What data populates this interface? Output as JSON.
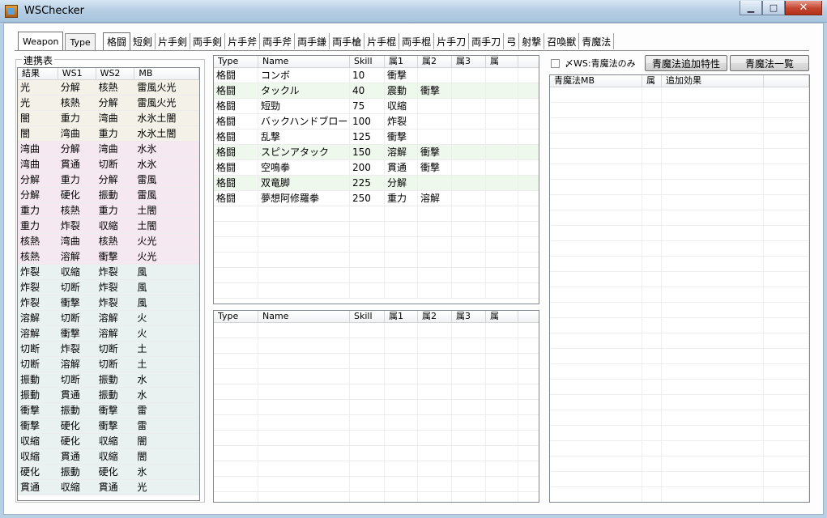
{
  "window": {
    "title": "WSChecker",
    "minimize": "▁",
    "maximize": "□",
    "close": "✕"
  },
  "tabs_type": [
    {
      "label": "Weapon",
      "active": true
    },
    {
      "label": "Type",
      "active": false
    }
  ],
  "tabs_weapon": [
    {
      "label": "格闘",
      "active": true
    },
    {
      "label": "短剣"
    },
    {
      "label": "片手剣"
    },
    {
      "label": "両手剣"
    },
    {
      "label": "片手斧"
    },
    {
      "label": "両手斧"
    },
    {
      "label": "両手鎌"
    },
    {
      "label": "両手槍"
    },
    {
      "label": "片手棍"
    },
    {
      "label": "両手棍"
    },
    {
      "label": "片手刀"
    },
    {
      "label": "両手刀"
    },
    {
      "label": "弓"
    },
    {
      "label": "射撃"
    },
    {
      "label": "召喚獣"
    },
    {
      "label": "青魔法"
    }
  ],
  "chain_table": {
    "group_title": "連携表",
    "headers": [
      "結果",
      "WS1",
      "WS2",
      "MB"
    ],
    "rows": [
      [
        "光",
        "分解",
        "核熱",
        "雷風火光",
        "tan"
      ],
      [
        "光",
        "核熱",
        "分解",
        "雷風火光",
        "tan"
      ],
      [
        "闇",
        "重力",
        "湾曲",
        "水氷土闇",
        "tan"
      ],
      [
        "闇",
        "湾曲",
        "重力",
        "水氷土闇",
        "tan"
      ],
      [
        "湾曲",
        "分解",
        "湾曲",
        "水氷",
        "pink"
      ],
      [
        "湾曲",
        "貫通",
        "切断",
        "水氷",
        "pink"
      ],
      [
        "分解",
        "重力",
        "分解",
        "雷風",
        "pink"
      ],
      [
        "分解",
        "硬化",
        "振動",
        "雷風",
        "pink"
      ],
      [
        "重力",
        "核熱",
        "重力",
        "土闇",
        "pink"
      ],
      [
        "重力",
        "炸裂",
        "収縮",
        "土闇",
        "pink"
      ],
      [
        "核熱",
        "湾曲",
        "核熱",
        "火光",
        "pink"
      ],
      [
        "核熱",
        "溶解",
        "衝撃",
        "火光",
        "pink"
      ],
      [
        "炸裂",
        "収縮",
        "炸裂",
        "風",
        "blue"
      ],
      [
        "炸裂",
        "切断",
        "炸裂",
        "風",
        "blue"
      ],
      [
        "炸裂",
        "衝撃",
        "炸裂",
        "風",
        "blue"
      ],
      [
        "溶解",
        "切断",
        "溶解",
        "火",
        "blue"
      ],
      [
        "溶解",
        "衝撃",
        "溶解",
        "火",
        "blue"
      ],
      [
        "切断",
        "炸裂",
        "切断",
        "土",
        "blue"
      ],
      [
        "切断",
        "溶解",
        "切断",
        "土",
        "blue"
      ],
      [
        "振動",
        "切断",
        "振動",
        "水",
        "blue"
      ],
      [
        "振動",
        "貫通",
        "振動",
        "水",
        "blue"
      ],
      [
        "衝撃",
        "振動",
        "衝撃",
        "雷",
        "blue"
      ],
      [
        "衝撃",
        "硬化",
        "衝撃",
        "雷",
        "blue"
      ],
      [
        "収縮",
        "硬化",
        "収縮",
        "闇",
        "blue"
      ],
      [
        "収縮",
        "貫通",
        "収縮",
        "闇",
        "blue"
      ],
      [
        "硬化",
        "振動",
        "硬化",
        "氷",
        "blue"
      ],
      [
        "貫通",
        "収縮",
        "貫通",
        "光",
        "blue"
      ]
    ]
  },
  "ws_table": {
    "headers": [
      "Type",
      "Name",
      "Skill",
      "属1",
      "属2",
      "属3",
      "属"
    ],
    "rows": [
      [
        "格闘",
        "コンボ",
        "10",
        "衝撃",
        "",
        "",
        "",
        false
      ],
      [
        "格闘",
        "タックル",
        "40",
        "震動",
        "衝撃",
        "",
        "",
        true
      ],
      [
        "格闘",
        "短勁",
        "75",
        "収縮",
        "",
        "",
        "",
        false
      ],
      [
        "格闘",
        "バックハンドブロー",
        "100",
        "炸裂",
        "",
        "",
        "",
        false
      ],
      [
        "格闘",
        "乱撃",
        "125",
        "衝撃",
        "",
        "",
        "",
        false
      ],
      [
        "格闘",
        "スピンアタック",
        "150",
        "溶解",
        "衝撃",
        "",
        "",
        true
      ],
      [
        "格闘",
        "空鳴拳",
        "200",
        "貫通",
        "衝撃",
        "",
        "",
        false
      ],
      [
        "格闘",
        "双竜脚",
        "225",
        "分解",
        "",
        "",
        "",
        true
      ],
      [
        "格闘",
        "夢想阿修羅拳",
        "250",
        "重力",
        "溶解",
        "",
        "",
        false
      ]
    ]
  },
  "ws_table2": {
    "headers": [
      "Type",
      "Name",
      "Skill",
      "属1",
      "属2",
      "属3",
      "属"
    ]
  },
  "blue_magic": {
    "checkbox_label": "〆WS:青魔法のみ",
    "add_trait_button": "青魔法追加特性",
    "list_button": "青魔法一覧",
    "headers": [
      "青魔法MB",
      "属",
      "追加効果"
    ]
  }
}
